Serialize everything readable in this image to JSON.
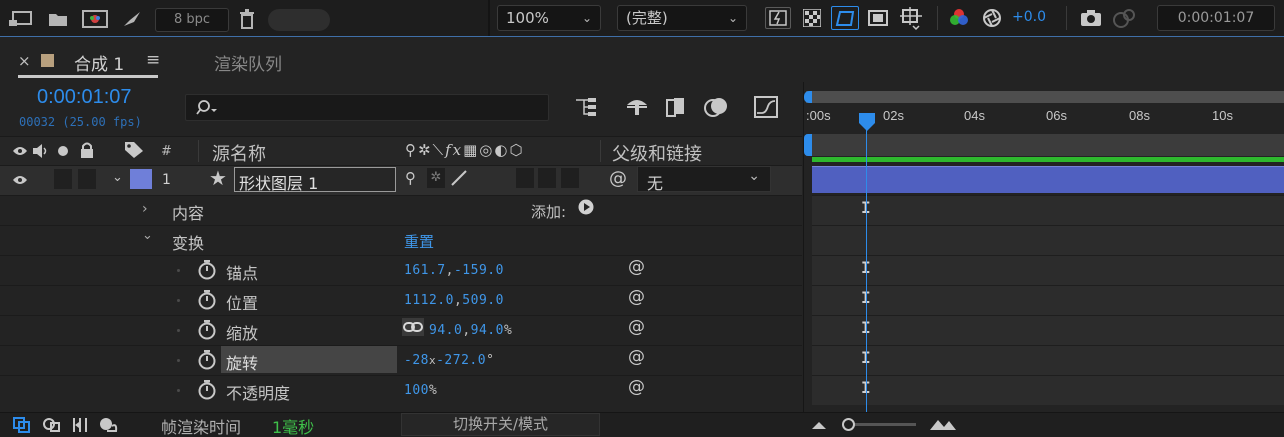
{
  "toolbar": {
    "bpc": "8 bpc",
    "zoom": "100%",
    "resolution": "(完整)",
    "exposure": "+0.0",
    "time": "0:00:01:07"
  },
  "panel": {
    "close": "×",
    "comp_tab": "合成 1",
    "menu": "≡",
    "render_queue_tab": "渲染队列"
  },
  "timeline": {
    "timecode": "0:00:01:07",
    "frames": "00032 (25.00 fps)",
    "search_placeholder": "",
    "ruler": [
      ":00s",
      "02s",
      "04s",
      "06s",
      "08s",
      "10s"
    ]
  },
  "columns": {
    "number": "#",
    "source_name": "源名称",
    "parent_link": "父级和链接"
  },
  "layer": {
    "index": "1",
    "name": "形状图层 1",
    "parent": "无",
    "label_color": "#6f7fd9"
  },
  "properties": {
    "contents": "内容",
    "add": "添加:",
    "transform": "变换",
    "reset": "重置",
    "anchor_label": "锚点",
    "anchor_x": "161.7",
    "anchor_y": "-159.0",
    "position_label": "位置",
    "position_x": "1112.0",
    "position_y": "509.0",
    "scale_label": "缩放",
    "scale_x": "94.0",
    "scale_y": "94.0",
    "scale_unit": "%",
    "rotation_label": "旋转",
    "rotation_rev": "-28",
    "rotation_x": "x",
    "rotation_deg": "-272.0",
    "rotation_unit": "°",
    "opacity_label": "不透明度",
    "opacity": "100",
    "opacity_unit": "%"
  },
  "bottom": {
    "render_time_label": "帧渲染时间",
    "render_time_value": "1毫秒",
    "toggle": "切换开关/模式"
  },
  "colors": {
    "accent": "#2d8ceb",
    "layer_bar": "#5060c0",
    "work_area": "#2eb82e"
  }
}
